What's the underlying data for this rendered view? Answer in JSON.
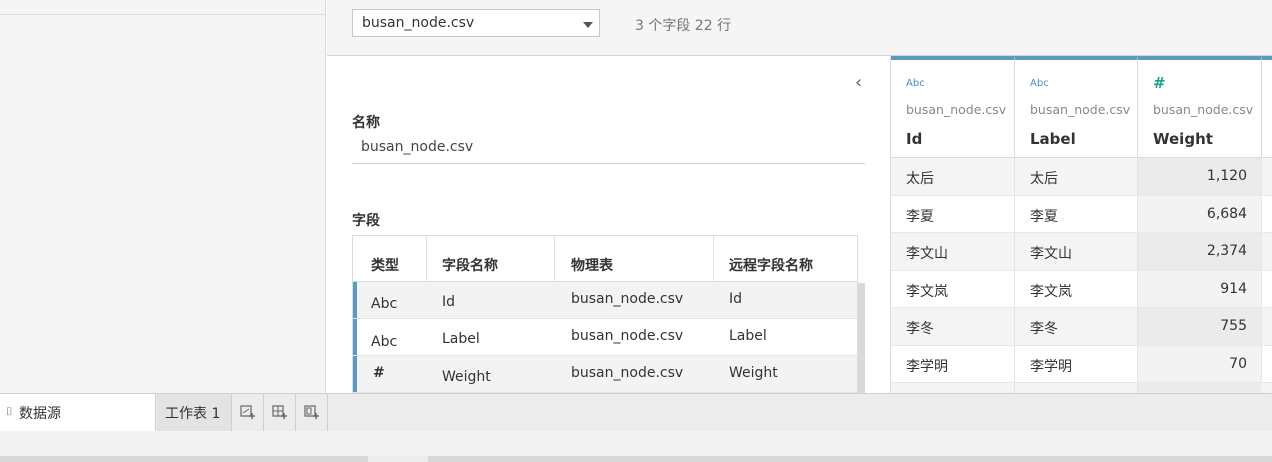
{
  "topbar": {
    "file_select_value": "busan_node.csv",
    "summary": "3 个字段 22 行"
  },
  "details": {
    "name_label": "名称",
    "name_value": "busan_node.csv",
    "fields_label": "字段"
  },
  "fields_table": {
    "headers": [
      "类型",
      "字段名称",
      "物理表",
      "远程字段名称"
    ],
    "rows": [
      {
        "type_icon": "Abc",
        "name": "Id",
        "table": "busan_node.csv",
        "remote": "Id"
      },
      {
        "type_icon": "Abc",
        "name": "Label",
        "table": "busan_node.csv",
        "remote": "Label"
      },
      {
        "type_icon": "#",
        "name": "Weight",
        "table": "busan_node.csv",
        "remote": "Weight"
      }
    ]
  },
  "grid": {
    "columns": [
      {
        "icon": "Abc",
        "source": "busan_node.csv",
        "name": "Id"
      },
      {
        "icon": "Abc",
        "source": "busan_node.csv",
        "name": "Label"
      },
      {
        "icon": "#",
        "source": "busan_node.csv",
        "name": "Weight"
      }
    ],
    "rows": [
      {
        "id": "太后",
        "label": "太后",
        "weight": "1,120"
      },
      {
        "id": "李夏",
        "label": "李夏",
        "weight": "6,684"
      },
      {
        "id": "李文山",
        "label": "李文山",
        "weight": "2,374"
      },
      {
        "id": "李文岚",
        "label": "李文岚",
        "weight": "914"
      },
      {
        "id": "李冬",
        "label": "李冬",
        "weight": "755"
      },
      {
        "id": "李学明",
        "label": "李学明",
        "weight": "70"
      }
    ]
  },
  "tabs": {
    "datasource_label": "数据源",
    "sheet1_label": "工作表 1"
  },
  "colors": {
    "accent": "#5f99c0",
    "string_icon": "#4b8bbd",
    "number_icon": "#1aa38a"
  },
  "icons": {
    "string_type": "abc-icon",
    "number_type": "hash-icon",
    "collapse": "chevron-left-icon",
    "dropdown": "caret-down-icon",
    "datasource": "database-icon",
    "new_sheet": "new-worksheet-icon",
    "new_dashboard": "new-dashboard-icon",
    "new_story": "new-story-icon"
  }
}
